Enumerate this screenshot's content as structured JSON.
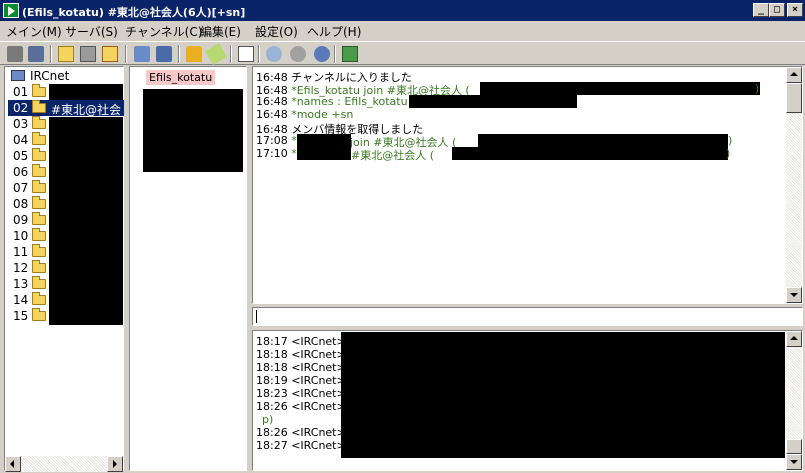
{
  "window": {
    "title": "(Efils_kotatu) #東北@社会人(6人)[+sn]",
    "buttons": {
      "minimize": "_",
      "maximize": "□",
      "close": "×"
    }
  },
  "menu": [
    "メイン(M)",
    "サーバ(S)",
    "チャンネル(C)",
    "編集(E)",
    "設定(O)",
    "ヘルプ(H)"
  ],
  "toolbar": {
    "icons": [
      "server-connect-icon",
      "server-disconnect-icon",
      "channel-join-icon",
      "channel-part-icon",
      "channel-list-icon",
      "dcc-send-icon",
      "dcc-chat-icon",
      "lock-icon",
      "edit-icon",
      "checklist-icon",
      "search-icon",
      "talk-icon",
      "sound-icon",
      "exit-icon"
    ]
  },
  "tree": {
    "root": "IRCnet",
    "rows": [
      {
        "num": "01",
        "label": ""
      },
      {
        "num": "02",
        "label": "#東北@社会"
      },
      {
        "num": "03",
        "label": ""
      },
      {
        "num": "04",
        "label": ""
      },
      {
        "num": "05",
        "label": ""
      },
      {
        "num": "06",
        "label": ""
      },
      {
        "num": "07",
        "label": ""
      },
      {
        "num": "08",
        "label": ""
      },
      {
        "num": "09",
        "label": ""
      },
      {
        "num": "10",
        "label": ""
      },
      {
        "num": "11",
        "label": ""
      },
      {
        "num": "12",
        "label": ""
      },
      {
        "num": "13",
        "label": ""
      },
      {
        "num": "14",
        "label": ""
      },
      {
        "num": "15",
        "label": ""
      }
    ],
    "selected_index": 1
  },
  "nicklist": {
    "self": "Efils_kotatu"
  },
  "channel_log": [
    {
      "time": "16:48",
      "text": "チャンネルに入りました",
      "color": "#000000"
    },
    {
      "time": "16:48",
      "text": "*Efils_kotatu join #東北@社会人 (",
      "tail": ")",
      "color": "#3a7a20"
    },
    {
      "time": "16:48",
      "text": "*names : Efils_kotatu",
      "color": "#3a7a20"
    },
    {
      "time": "16:48",
      "text": "*mode +sn",
      "color": "#3a7a20"
    },
    {
      "time": "16:48",
      "text": "メンバ情報を取得しました",
      "color": "#000000"
    },
    {
      "time": "17:08",
      "text": "*",
      "mid": " join #東北@社会人 (",
      "tail": ")",
      "color": "#3a7a20"
    },
    {
      "time": "17:10",
      "text": "*",
      "mid": " #東北@社会人 (",
      "tail": ")",
      "color": "#3a7a20"
    }
  ],
  "input": {
    "value": ""
  },
  "server_log": [
    {
      "time": "18:17",
      "text": "<IRCnet>"
    },
    {
      "time": "18:18",
      "text": "<IRCnet>"
    },
    {
      "time": "18:18",
      "text": "<IRCnet>"
    },
    {
      "time": "18:19",
      "text": "<IRCnet>"
    },
    {
      "time": "18:23",
      "text": "<IRCnet>"
    },
    {
      "time": "18:26",
      "text": "<IRCnet>"
    },
    {
      "time": "",
      "text": "p)"
    },
    {
      "time": "18:26",
      "text": "<IRCnet>"
    },
    {
      "time": "18:27",
      "text": "<IRCnet>"
    }
  ]
}
